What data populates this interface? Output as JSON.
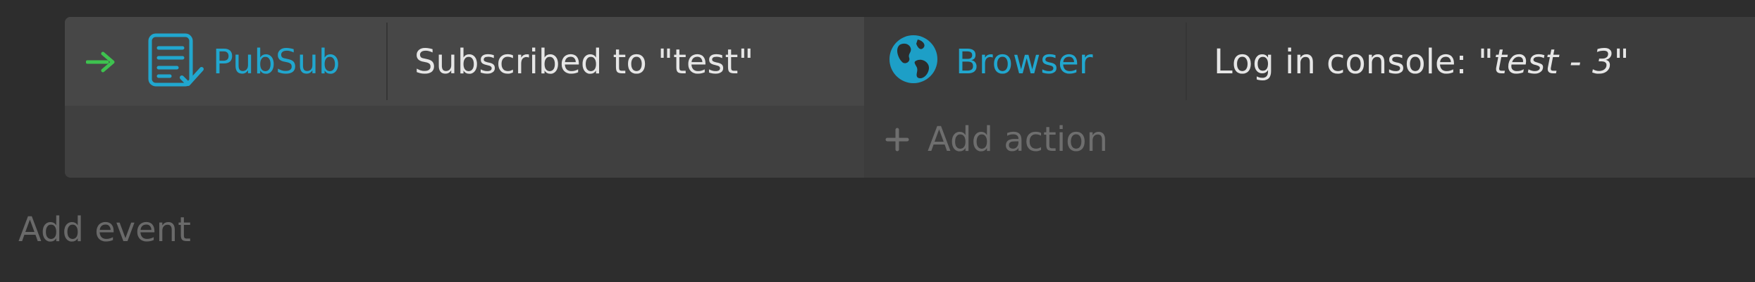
{
  "event": {
    "condition": {
      "object_name": "PubSub",
      "object_icon": "pubsub-list-icon",
      "description": "Subscribed to \"test\""
    },
    "action": {
      "object_name": "Browser",
      "object_icon": "globe-icon",
      "description_prefix": "Log in console: \"",
      "description_value": "test - 3",
      "description_suffix": "\""
    },
    "add_action_label": "Add action"
  },
  "add_event_label": "Add event",
  "colors": {
    "accent": "#21a7cf",
    "trigger_arrow": "#3ec24f",
    "background": "#2d2d2d"
  }
}
